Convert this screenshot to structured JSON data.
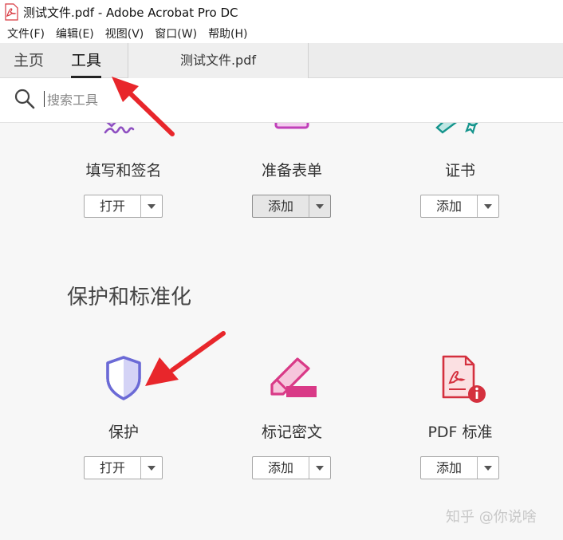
{
  "window": {
    "title": "测试文件.pdf - Adobe Acrobat Pro DC",
    "app_icon": "acrobat-pdf-icon"
  },
  "menu": [
    "文件(F)",
    "编辑(E)",
    "视图(V)",
    "窗口(W)",
    "帮助(H)"
  ],
  "tabs": {
    "home": "主页",
    "tools": "工具",
    "document": "测试文件.pdf"
  },
  "search": {
    "placeholder": "搜索工具",
    "icon": "search-icon"
  },
  "tools_row1": [
    {
      "name": "填写和签名",
      "button": "打开",
      "icon": "fill-sign-icon",
      "icon_color": "#8e4fc1"
    },
    {
      "name": "准备表单",
      "button": "添加",
      "icon": "prepare-form-icon",
      "icon_color": "#c03fb9"
    },
    {
      "name": "证书",
      "button": "添加",
      "icon": "certificate-icon",
      "icon_color": "#14948c"
    }
  ],
  "section": {
    "title": "保护和标准化"
  },
  "tools_row2": [
    {
      "name": "保护",
      "button": "打开",
      "icon": "shield-icon",
      "icon_color": "#6b6ad6"
    },
    {
      "name": "标记密文",
      "button": "添加",
      "icon": "redact-icon",
      "icon_color": "#d93a87"
    },
    {
      "name": "PDF 标准",
      "button": "添加",
      "icon": "pdf-standard-icon",
      "icon_color": "#d4303e"
    }
  ],
  "watermark": "知乎 @你说啥",
  "colors": {
    "annotation_arrow": "#e8262b",
    "tab_bar": "#ececec",
    "background": "#f7f7f7"
  }
}
